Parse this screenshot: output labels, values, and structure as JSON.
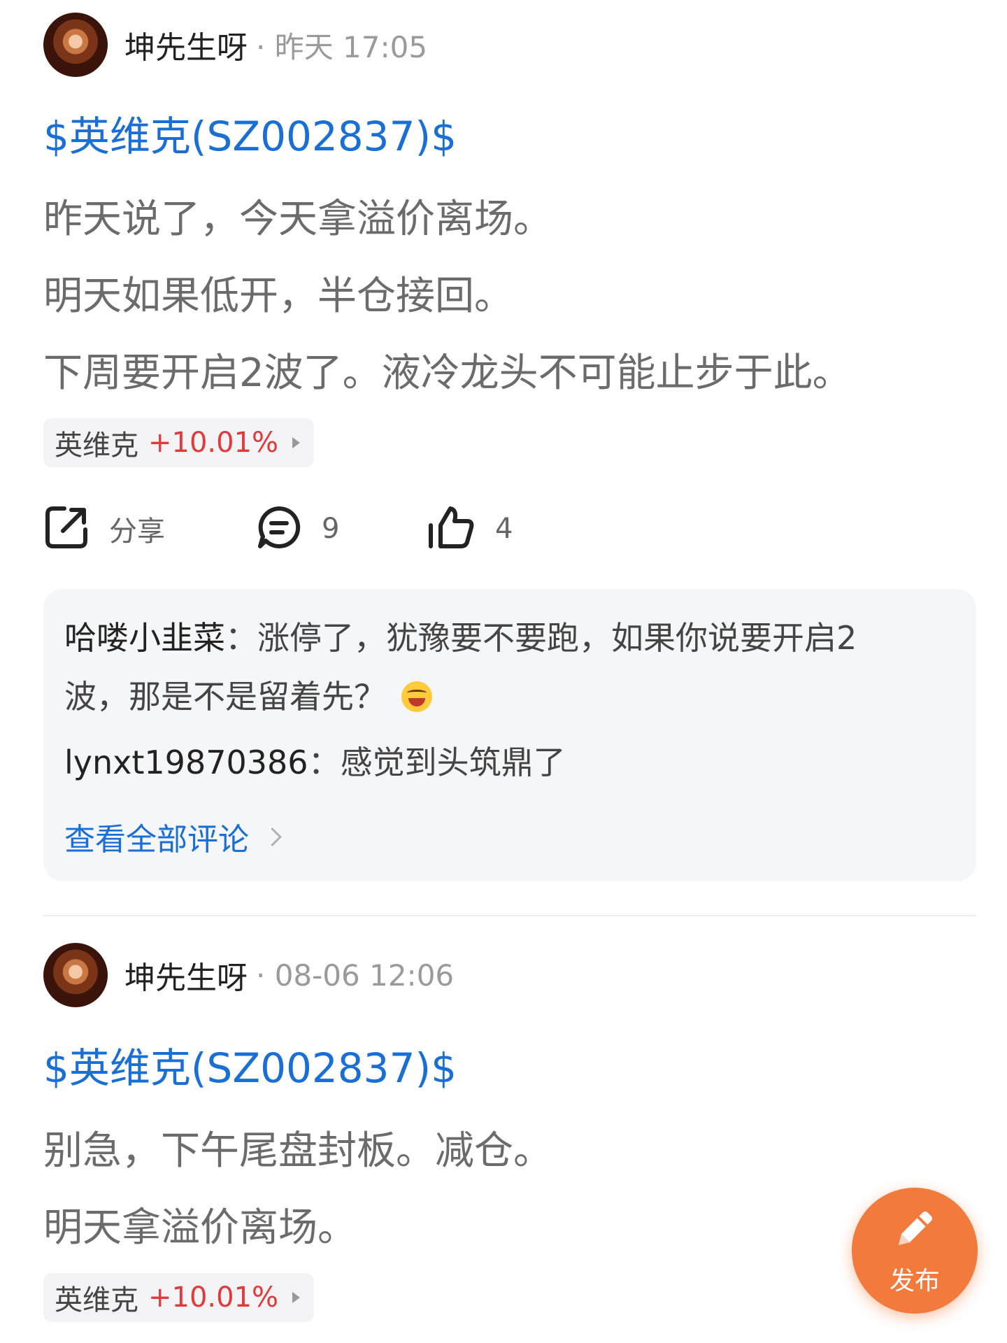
{
  "posts": [
    {
      "author": "坤先生呀",
      "meta": "· 昨天 17:05",
      "cashtag": "$英维克(SZ002837)$",
      "paragraphs": [
        "昨天说了，今天拿溢价离场。",
        "明天如果低开，半仓接回。",
        "下周要开启2波了。液冷龙头不可能止步于此。"
      ],
      "stock": {
        "name": "英维克",
        "change": "+10.01%"
      },
      "actions": {
        "share_label": "分享",
        "comment_count": "9",
        "like_count": "4"
      },
      "comments": {
        "items": [
          {
            "user": "哈喽小韭菜",
            "text_line1": "：涨停了，犹豫要不要跑，如果你说要开启2",
            "text_line2": "波，那是不是留着先？",
            "emoji": "laughing-tears"
          },
          {
            "user": "lynxt19870386",
            "text": "：感觉到头筑鼎了"
          }
        ],
        "view_all": "查看全部评论"
      }
    },
    {
      "author": "坤先生呀",
      "meta": "· 08-06 12:06",
      "cashtag": "$英维克(SZ002837)$",
      "paragraphs": [
        "别急，下午尾盘封板。减仓。",
        "明天拿溢价离场。"
      ],
      "stock": {
        "name": "英维克",
        "change": "+10.01%"
      }
    }
  ],
  "fab": {
    "label": "发布",
    "icon": "pencil-icon",
    "color": "#f17a3c"
  },
  "colors": {
    "link": "#1a6fd6",
    "up": "#e03a3a",
    "body_text": "#6b6b6b"
  }
}
